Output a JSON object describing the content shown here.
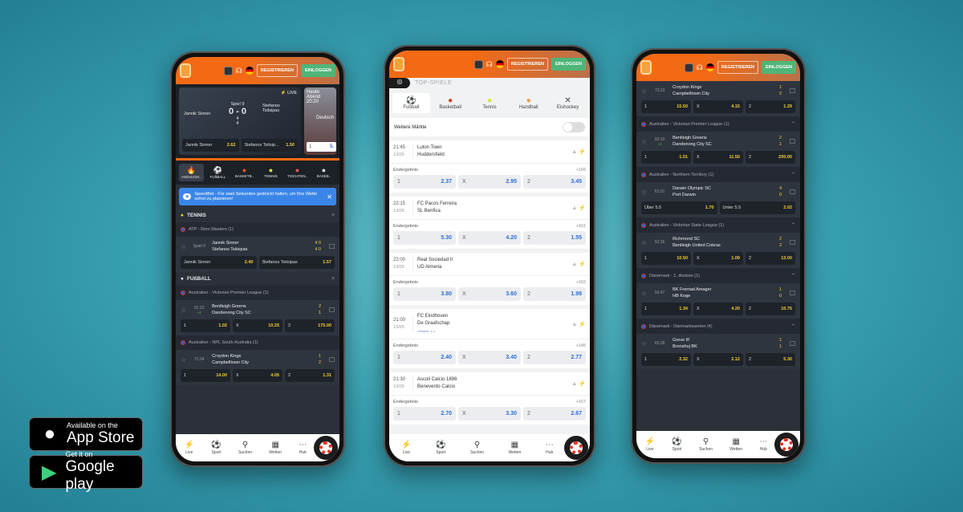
{
  "header": {
    "register": "REGISTRIEREN",
    "login": "EINLOGGEN"
  },
  "nav": [
    {
      "label": "Live",
      "icon": "lightning-icon"
    },
    {
      "label": "Sport",
      "icon": "sport-icon"
    },
    {
      "label": "Suchen",
      "icon": "search-icon"
    },
    {
      "label": "Wetten",
      "icon": "betslip-icon"
    },
    {
      "label": "Hub",
      "icon": "more-icon"
    }
  ],
  "left": {
    "hero": {
      "live": "LIVE",
      "player1": "Jannik Sinner",
      "player2": "Stefanos Tsitsipas",
      "game": "Spiel 9",
      "score": "0 - 0",
      "games": [
        "4",
        "4"
      ],
      "odds": [
        {
          "label": "Jannik Sinner",
          "value": "2.62"
        },
        {
          "label": "Stefanos Tsitsip...",
          "value": "1.50"
        }
      ],
      "side_title": "Heute Abend 20:20",
      "side_team": "Deutsch",
      "side_odd_label": "1",
      "side_odd": "5."
    },
    "sports": [
      "HIGHLIGH..",
      "FUßBALL",
      "BASKETB..",
      "TENNIS",
      "TISCHTEN..",
      "BASEB.."
    ],
    "banner": "SpeedBet - Für zwei Sekunden gedrückt halten, um Ihre Wette sofort zu platzieren!",
    "sections": [
      {
        "title": "TENNIS",
        "leagues": [
          {
            "name": "ATP - Rom Masters (1)",
            "matches": [
              {
                "time": "Spiel 9",
                "sub": "",
                "teams": [
                  "Jannik Sinner",
                  "Stefanos Tsitsipas"
                ],
                "scores": [
                  "4 0",
                  "4 0"
                ],
                "odds": [
                  {
                    "l": "Jannik Sinner",
                    "v": "2.40"
                  },
                  {
                    "l": "Stefanos Tsitsipas",
                    "v": "1.57"
                  }
                ]
              }
            ]
          }
        ]
      },
      {
        "title": "FUßBALL",
        "leagues": [
          {
            "name": "Australien - Victorian Premier League (1)",
            "matches": [
              {
                "time": "91:10",
                "sub": "+4",
                "teams": [
                  "Bentleigh Greens",
                  "Dandenong City SC"
                ],
                "scores": [
                  "2",
                  "1"
                ],
                "odds": [
                  {
                    "l": "1",
                    "v": "1.02"
                  },
                  {
                    "l": "X",
                    "v": "10.25"
                  },
                  {
                    "l": "2",
                    "v": "175.00"
                  }
                ]
              }
            ]
          },
          {
            "name": "Australien - NPL South Australia (1)",
            "matches": [
              {
                "time": "71:24",
                "sub": "",
                "teams": [
                  "Croydon Kings",
                  "Campbelltown City"
                ],
                "scores": [
                  "1",
                  "2"
                ],
                "odds": [
                  {
                    "l": "1",
                    "v": "14.00"
                  },
                  {
                    "l": "X",
                    "v": "4.05"
                  },
                  {
                    "l": "2",
                    "v": "1.31"
                  }
                ]
              }
            ]
          }
        ]
      }
    ]
  },
  "center": {
    "top_label": "TOP-SPIELE",
    "sports": [
      "Fußball",
      "Basketball",
      "Tennis",
      "Handball",
      "Eishockey"
    ],
    "more_markets": "Weitere Märkte",
    "more_markets_on": false,
    "market": "Endergebnis",
    "matches": [
      {
        "time": "21:45",
        "date": "13/05",
        "teams": [
          "Luton Town",
          "Huddersfield"
        ],
        "note": "",
        "count": "+166",
        "odds": [
          {
            "l": "1",
            "v": "2.37"
          },
          {
            "l": "X",
            "v": "2.95"
          },
          {
            "l": "2",
            "v": "3.45"
          }
        ]
      },
      {
        "time": "22:15",
        "date": "13/05",
        "teams": [
          "FC Pacos Ferreira",
          "SL Benfica"
        ],
        "note": "",
        "count": "+161",
        "odds": [
          {
            "l": "1",
            "v": "5.30"
          },
          {
            "l": "X",
            "v": "4.20"
          },
          {
            "l": "2",
            "v": "1.55"
          }
        ]
      },
      {
        "time": "22:00",
        "date": "13/05",
        "teams": [
          "Real Sociedad II",
          "UD Almeria"
        ],
        "note": "",
        "count": "+162",
        "odds": [
          {
            "l": "1",
            "v": "3.80"
          },
          {
            "l": "X",
            "v": "3.60"
          },
          {
            "l": "2",
            "v": "1.98"
          }
        ]
      },
      {
        "time": "21:00",
        "date": "13/05",
        "teams": [
          "FC Eindhoven",
          "De Graafschap"
        ],
        "note": "Hinspiel: 1-1",
        "count": "+145",
        "odds": [
          {
            "l": "1",
            "v": "2.40"
          },
          {
            "l": "X",
            "v": "3.40"
          },
          {
            "l": "2",
            "v": "2.77"
          }
        ]
      },
      {
        "time": "21:30",
        "date": "13/05",
        "teams": [
          "Ascoli Calcio 1898",
          "Benevento Calcio"
        ],
        "note": "",
        "count": "+167",
        "odds": [
          {
            "l": "1",
            "v": "2.70"
          },
          {
            "l": "X",
            "v": "3.30"
          },
          {
            "l": "2",
            "v": "2.67"
          }
        ]
      }
    ]
  },
  "right": {
    "leagues": [
      {
        "name": "",
        "matches": [
          {
            "time": "73:23",
            "sub": "",
            "teams": [
              "Croydon Kings",
              "Campbelltown City"
            ],
            "scores": [
              "1",
              "2"
            ],
            "odds": [
              {
                "l": "1",
                "v": "15.50"
              },
              {
                "l": "X",
                "v": "4.15"
              },
              {
                "l": "2",
                "v": "1.29"
              }
            ]
          }
        ]
      },
      {
        "name": "Australien - Victorian Premier League (1)",
        "matches": [
          {
            "time": "93:10",
            "sub": "+4",
            "teams": [
              "Bentleigh Greens",
              "Dandenong City SC"
            ],
            "scores": [
              "2",
              "1"
            ],
            "odds": [
              {
                "l": "1",
                "v": "1.01"
              },
              {
                "l": "X",
                "v": "11.50"
              },
              {
                "l": "2",
                "v": "200.00"
              }
            ]
          }
        ]
      },
      {
        "name": "Australien - Northern Territory (1)",
        "matches": [
          {
            "time": "61:01",
            "sub": "",
            "teams": [
              "Darwin Olympic SC",
              "Port Darwin"
            ],
            "scores": [
              "4",
              "0"
            ],
            "odds": [
              {
                "l": "Über 5.5",
                "v": "1.70"
              },
              {
                "l": "Unter 5.5",
                "v": "2.02"
              }
            ]
          }
        ]
      },
      {
        "name": "Australien - Victorian State League (1)",
        "matches": [
          {
            "time": "92:36",
            "sub": "",
            "teams": [
              "Richmond SC",
              "Bentleigh United Cobras"
            ],
            "scores": [
              "2",
              "2"
            ],
            "odds": [
              {
                "l": "1",
                "v": "10.50"
              },
              {
                "l": "X",
                "v": "1.09"
              },
              {
                "l": "2",
                "v": "13.00"
              }
            ]
          }
        ]
      },
      {
        "name": "Dänemark - 1. division (1)",
        "matches": [
          {
            "time": "56:47",
            "sub": "",
            "teams": [
              "BK Fremad Amager",
              "HB Koge"
            ],
            "scores": [
              "1",
              "0"
            ],
            "odds": [
              {
                "l": "1",
                "v": "1.34"
              },
              {
                "l": "X",
                "v": "4.20"
              },
              {
                "l": "2",
                "v": "10.75"
              }
            ]
          }
        ]
      },
      {
        "name": "Dänemark - Danmarksserien (4)",
        "matches": [
          {
            "time": "65:28",
            "sub": "",
            "teams": [
              "Greve IF",
              "Bronshoj BK"
            ],
            "scores": [
              "1",
              "1"
            ],
            "odds": [
              {
                "l": "1",
                "v": "2.32"
              },
              {
                "l": "X",
                "v": "2.12"
              },
              {
                "l": "2",
                "v": "5.30"
              }
            ]
          }
        ]
      }
    ]
  },
  "stores": {
    "apple_small": "Available on the",
    "apple_big": "App Store",
    "google_small": "Get it on",
    "google_big": "Google play"
  }
}
